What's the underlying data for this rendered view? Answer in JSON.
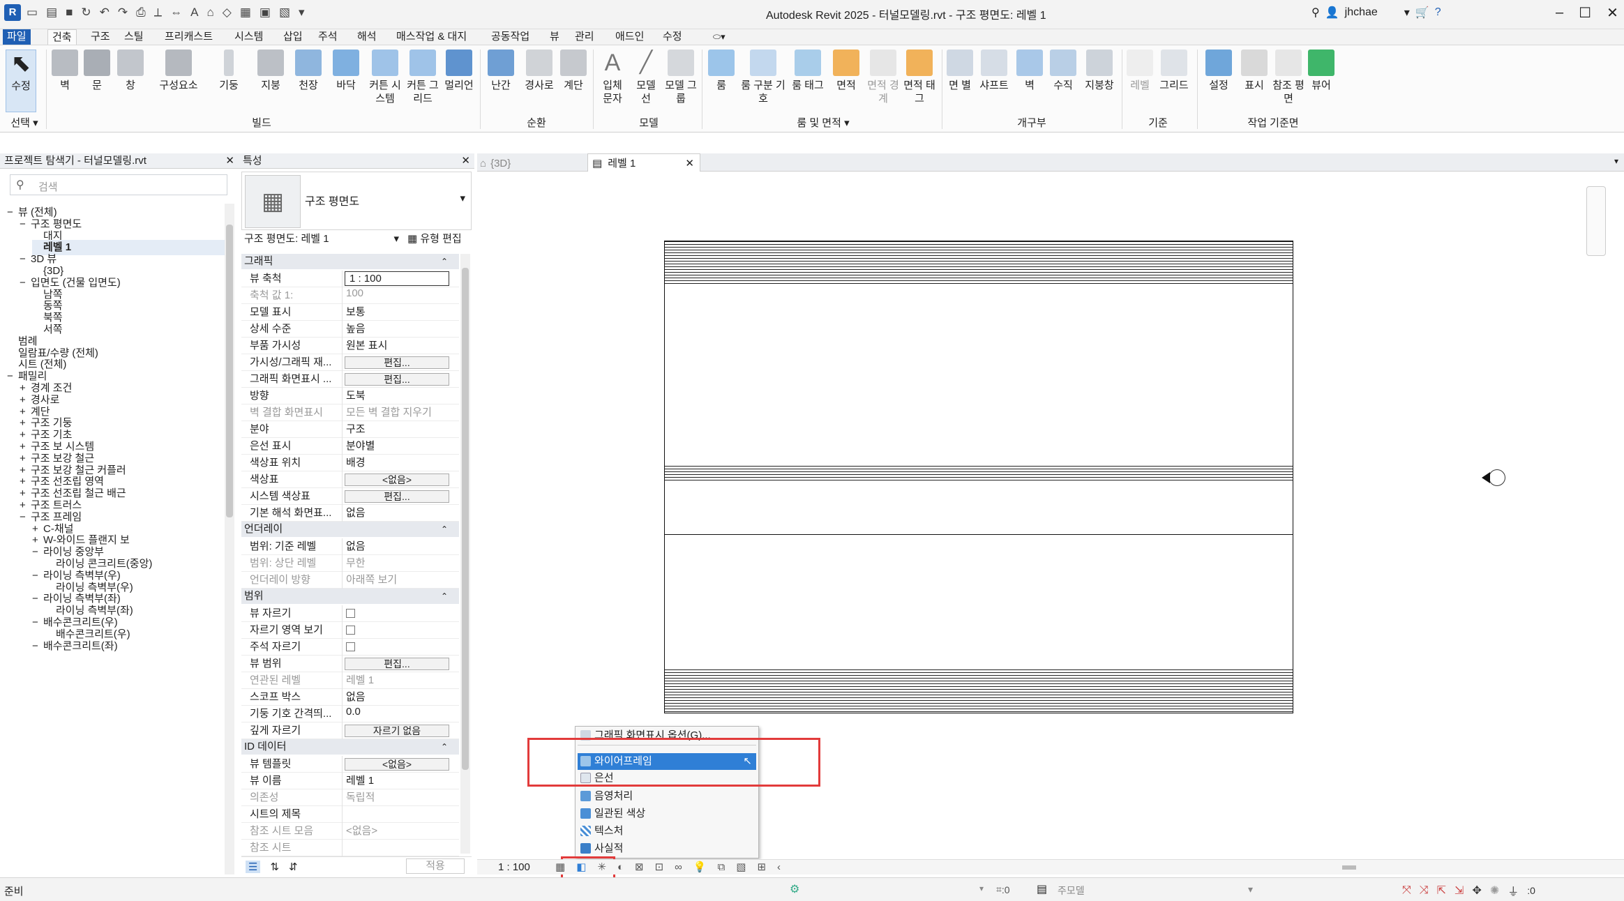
{
  "titlebar": {
    "title": "Autodesk Revit 2025 - 터널모델링.rvt - 구조 평면도: 레벨 1",
    "user": "jhchae"
  },
  "menu_tabs": [
    "파일",
    "건축",
    "구조",
    "스틸",
    "프리캐스트",
    "시스템",
    "삽입",
    "주석",
    "해석",
    "매스작업 & 대지",
    "공동작업",
    "뷰",
    "관리",
    "애드인",
    "수정"
  ],
  "ribbon": {
    "buttons": [
      "수정",
      "벽",
      "문",
      "창",
      "구성요소",
      "기둥",
      "지붕",
      "천장",
      "바닥",
      "커튼 시스템",
      "커튼 그리드",
      "멀리언",
      "난간",
      "경사로",
      "계단",
      "입체 문자",
      "모델 선",
      "모델 그룹",
      "룸",
      "룸 구분 기호",
      "룸 태그",
      "면적",
      "면적 경계",
      "면적 태그",
      "면 별",
      "샤프트",
      "벽",
      "수직",
      "지붕창",
      "레벨",
      "그리드",
      "설정",
      "표시",
      "참조 평면",
      "뷰어"
    ],
    "groups": [
      "선택",
      "빌드",
      "순환",
      "모델",
      "룸 및 면적",
      "개구부",
      "기준",
      "작업 기준면"
    ]
  },
  "browser": {
    "title": "프로젝트 탐색기 - 터널모델링.rvt",
    "search_placeholder": "검색",
    "items": [
      "뷰 (전체)",
      "구조 평면도",
      "대지",
      "레벨 1",
      "3D 뷰",
      "{3D}",
      "입면도 (건물 입면도)",
      "남쪽",
      "동쪽",
      "북쪽",
      "서쪽",
      "범례",
      "일람표/수량 (전체)",
      "시트 (전체)",
      "패밀리",
      "경계 조건",
      "경사로",
      "계단",
      "구조 기둥",
      "구조 기초",
      "구조 보 시스템",
      "구조 보강 철근",
      "구조 보강 철근 커플러",
      "구조 선조립 영역",
      "구조 선조립 철근 배근",
      "구조 트러스",
      "구조 프레임",
      "C-채널",
      "W-와이드 플랜지 보",
      "라이닝 중앙부",
      "라이닝 콘크리트(중앙)",
      "라이닝 측벽부(우)",
      "라이닝 측벽부(우)",
      "라이닝 측벽부(좌)",
      "라이닝 측벽부(좌)",
      "배수콘크리트(우)",
      "배수콘크리트(우)",
      "배수콘크리트(좌)"
    ]
  },
  "properties": {
    "title": "특성",
    "type_name": "구조 평면도",
    "selector": "구조 평면도: 레벨 1",
    "edit_type": "유형 편집",
    "apply": "적용",
    "sections": {
      "graphics": "그래픽",
      "underlay": "언더레이",
      "extents": "범위",
      "identity": "ID 데이터"
    },
    "rows": [
      {
        "k": "뷰 축척",
        "v": "1 : 100"
      },
      {
        "k": "축척 값    1:",
        "v": "100"
      },
      {
        "k": "모델 표시",
        "v": "보통"
      },
      {
        "k": "상세 수준",
        "v": "높음"
      },
      {
        "k": "부품 가시성",
        "v": "원본 표시"
      },
      {
        "k": "가시성/그래픽 재...",
        "v": "편집..."
      },
      {
        "k": "그래픽 화면표시 ...",
        "v": "편집..."
      },
      {
        "k": "방향",
        "v": "도북"
      },
      {
        "k": "벽 결합 화면표시",
        "v": "모든 벽 결합 지우기"
      },
      {
        "k": "분야",
        "v": "구조"
      },
      {
        "k": "은선 표시",
        "v": "분야별"
      },
      {
        "k": "색상표 위치",
        "v": "배경"
      },
      {
        "k": "색상표",
        "v": "<없음>"
      },
      {
        "k": "시스템 색상표",
        "v": "편집..."
      },
      {
        "k": "기본 해석 화면표...",
        "v": "없음"
      },
      {
        "k": "범위: 기준 레벨",
        "v": "없음"
      },
      {
        "k": "범위: 상단 레벨",
        "v": "무한"
      },
      {
        "k": "언더레이 방향",
        "v": "아래쪽 보기"
      },
      {
        "k": "뷰 자르기",
        "v": ""
      },
      {
        "k": "자르기 영역 보기",
        "v": ""
      },
      {
        "k": "주석 자르기",
        "v": ""
      },
      {
        "k": "뷰 범위",
        "v": "편집..."
      },
      {
        "k": "연관된 레벨",
        "v": "레벨 1"
      },
      {
        "k": "스코프 박스",
        "v": "없음"
      },
      {
        "k": "기둥 기호 간격띄...",
        "v": "0.0"
      },
      {
        "k": "깊게 자르기",
        "v": "자르기 없음"
      },
      {
        "k": "뷰 템플릿",
        "v": "<없음>"
      },
      {
        "k": "뷰 이름",
        "v": "레벨 1"
      },
      {
        "k": "의존성",
        "v": "독립적"
      },
      {
        "k": "시트의 제목",
        "v": ""
      },
      {
        "k": "참조 시트 모음",
        "v": "<없음>"
      },
      {
        "k": "참조 시트",
        "v": ""
      }
    ]
  },
  "view_tabs": [
    "{3D}",
    "레벨 1"
  ],
  "context_menu": {
    "items": [
      "그래픽 화면표시 옵션(G)...",
      "와이어프레임",
      "은선",
      "음영처리",
      "일관된 색상",
      "텍스처",
      "사실적"
    ],
    "selected": "와이어프레임"
  },
  "view_bar": {
    "scale": "1 : 100"
  },
  "status": {
    "left": "준비",
    "zero1": ":0",
    "model": "주모델",
    "filter": ":0"
  },
  "colors": {
    "accent": "#0c64c0",
    "highlight": "#e23b3b",
    "selected_bg": "#2f7fd6"
  }
}
